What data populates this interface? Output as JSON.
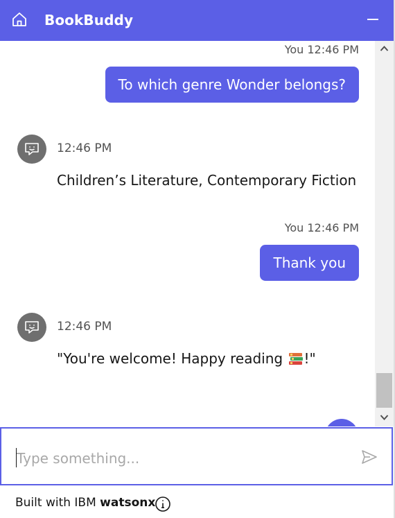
{
  "header": {
    "title": "BookBuddy"
  },
  "messages": [
    {
      "sender": "user",
      "time": "You 12:46 PM",
      "text": "To which genre Wonder belongs?"
    },
    {
      "sender": "bot",
      "time": "12:46 PM",
      "text": "Children’s Literature, Contemporary Fiction"
    },
    {
      "sender": "user",
      "time": "You 12:46 PM",
      "text": "Thank you"
    },
    {
      "sender": "bot",
      "time": "12:46 PM",
      "text": "\"You're welcome! Happy reading ",
      "text_end": "!\"",
      "emoji": "books-emoji"
    }
  ],
  "help_button": {
    "label": "?"
  },
  "composer": {
    "placeholder": "Type something...",
    "value": ""
  },
  "footer": {
    "prefix": "Built with IBM ",
    "brand": "watsonx"
  },
  "colors": {
    "accent": "#5b5fe6",
    "bot_avatar": "#6f6f6f"
  }
}
